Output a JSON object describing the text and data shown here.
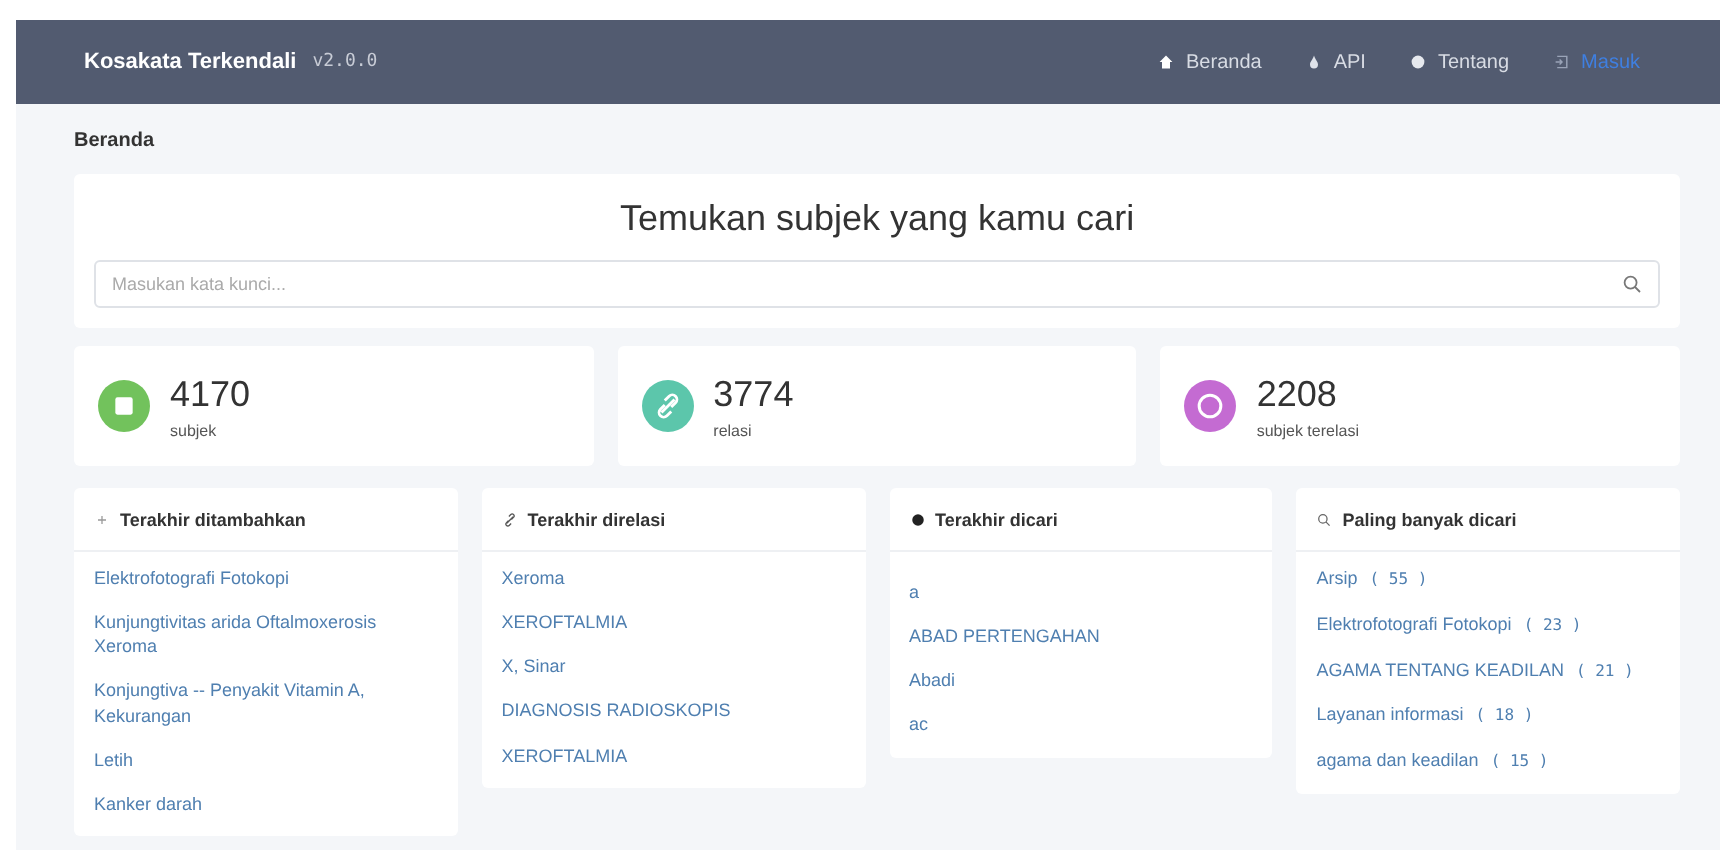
{
  "navbar": {
    "brand": "Kosakata Terkendali",
    "version": "v2.0.0",
    "links": [
      {
        "label": "Beranda",
        "kind": "home"
      },
      {
        "label": "API",
        "kind": "api"
      },
      {
        "label": "Tentang",
        "kind": "about"
      },
      {
        "label": "Masuk",
        "kind": "login"
      }
    ]
  },
  "breadcrumb": "Beranda",
  "search": {
    "title": "Temukan subjek yang kamu cari",
    "placeholder": "Masukan kata kunci..."
  },
  "stats": [
    {
      "value": "4170",
      "label": "subjek",
      "color": "#72c25c",
      "kind": "subjects"
    },
    {
      "value": "3774",
      "label": "relasi",
      "color": "#5cc6ab",
      "kind": "relations"
    },
    {
      "value": "2208",
      "label": "subjek terelasi",
      "color": "#c46bd2",
      "kind": "related"
    }
  ],
  "lists": [
    {
      "title": "Terakhir ditambahkan",
      "kind": "added",
      "items": [
        {
          "text": "Elektrofotografi Fotokopi"
        },
        {
          "text": "Kunjungtivitas arida Oftalmoxerosis Xeroma"
        },
        {
          "text": "Konjungtiva -- Penyakit Vitamin A, Kekurangan"
        },
        {
          "text": "Letih"
        },
        {
          "text": "Kanker darah"
        }
      ]
    },
    {
      "title": "Terakhir direlasi",
      "kind": "related",
      "items": [
        {
          "text": "Xeroma"
        },
        {
          "text": "XEROFTALMIA"
        },
        {
          "text": "X, Sinar"
        },
        {
          "text": "DIAGNOSIS RADIOSKOPIS"
        },
        {
          "text": "XEROFTALMIA"
        }
      ]
    },
    {
      "title": "Terakhir dicari",
      "kind": "searched",
      "items": [
        {
          "text": "a"
        },
        {
          "text": "ABAD PERTENGAHAN"
        },
        {
          "text": "Abadi"
        },
        {
          "text": "ac"
        }
      ]
    },
    {
      "title": "Paling banyak dicari",
      "kind": "popular",
      "items": [
        {
          "text": "Arsip",
          "count": "( 55 )"
        },
        {
          "text": "Elektrofotografi Fotokopi",
          "count": "( 23 )"
        },
        {
          "text": "AGAMA TENTANG KEADILAN",
          "count": "( 21 )"
        },
        {
          "text": "Layanan informasi",
          "count": "( 18 )"
        },
        {
          "text": "agama dan keadilan",
          "count": "( 15 )"
        }
      ]
    }
  ]
}
